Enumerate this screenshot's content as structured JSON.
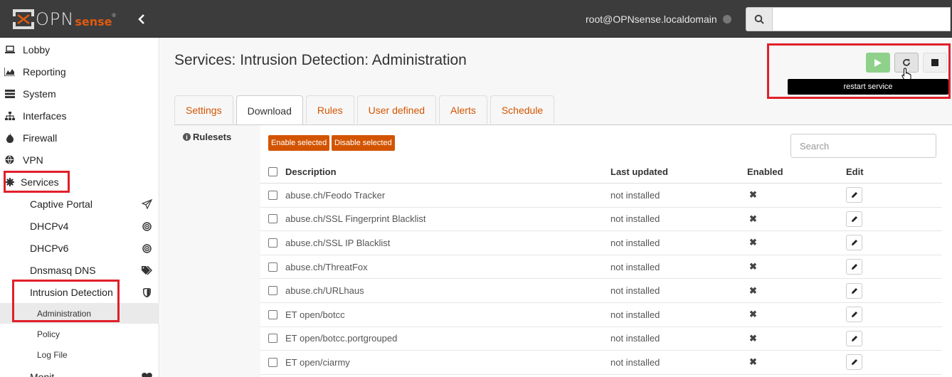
{
  "header": {
    "logo_text": "OPN",
    "logo_text2": "sense",
    "logo_tm": "®",
    "user": "root@OPNsense.localdomain",
    "search_placeholder": ""
  },
  "sidebar": {
    "items": [
      {
        "label": "Lobby",
        "icon": "laptop-icon"
      },
      {
        "label": "Reporting",
        "icon": "area-chart-icon"
      },
      {
        "label": "System",
        "icon": "server-icon"
      },
      {
        "label": "Interfaces",
        "icon": "sitemap-icon"
      },
      {
        "label": "Firewall",
        "icon": "fire-icon"
      },
      {
        "label": "VPN",
        "icon": "globe-icon"
      },
      {
        "label": "Services",
        "icon": "cog-icon"
      }
    ],
    "services_sub": [
      {
        "label": "Captive Portal",
        "icon": "paper-plane-icon"
      },
      {
        "label": "DHCPv4",
        "icon": "bullseye-icon"
      },
      {
        "label": "DHCPv6",
        "icon": "bullseye-icon"
      },
      {
        "label": "Dnsmasq DNS",
        "icon": "tags-icon"
      },
      {
        "label": "Intrusion Detection",
        "icon": "shield-icon"
      }
    ],
    "ids_sub": [
      {
        "label": "Administration"
      },
      {
        "label": "Policy"
      },
      {
        "label": "Log File"
      }
    ],
    "next_item": {
      "label": "Monit",
      "icon": "heartbeat-icon"
    }
  },
  "page": {
    "title": "Services: Intrusion Detection: Administration",
    "tooltip": "restart service",
    "tabs": [
      "Settings",
      "Download",
      "Rules",
      "User defined",
      "Alerts",
      "Schedule"
    ],
    "active_tab": "Download",
    "rulesets_label": "Rulesets",
    "enable_btn": "Enable selected",
    "disable_btn": "Disable selected",
    "search_placeholder": "Search",
    "columns": [
      "Description",
      "Last updated",
      "Enabled",
      "Edit"
    ],
    "rows": [
      {
        "description": "abuse.ch/Feodo Tracker",
        "updated": "not installed"
      },
      {
        "description": "abuse.ch/SSL Fingerprint Blacklist",
        "updated": "not installed"
      },
      {
        "description": "abuse.ch/SSL IP Blacklist",
        "updated": "not installed"
      },
      {
        "description": "abuse.ch/ThreatFox",
        "updated": "not installed"
      },
      {
        "description": "abuse.ch/URLhaus",
        "updated": "not installed"
      },
      {
        "description": "ET open/botcc",
        "updated": "not installed"
      },
      {
        "description": "ET open/botcc.portgrouped",
        "updated": "not installed"
      },
      {
        "description": "ET open/ciarmy",
        "updated": "not installed"
      }
    ]
  },
  "colors": {
    "accent": "#d35400",
    "topbar": "#3c3c3c",
    "highlight_box": "#e0202a",
    "start_button": "#8fd18b"
  }
}
